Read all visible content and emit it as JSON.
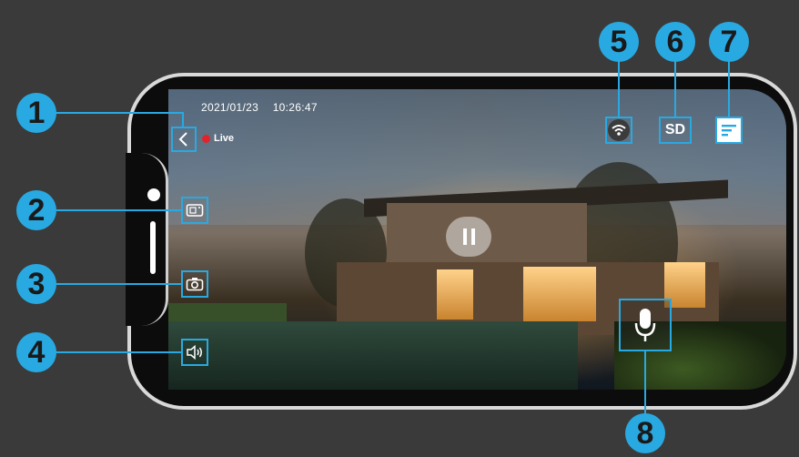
{
  "status": {
    "date": "2021/01/23",
    "time": "10:26:47",
    "live_label": "Live"
  },
  "controls": {
    "sd_label": "SD"
  },
  "callouts": [
    "1",
    "2",
    "3",
    "4",
    "5",
    "6",
    "7",
    "8"
  ],
  "icons": {
    "back": "chevron-left-icon",
    "snapshot": "screenshot-icon",
    "photo": "camera-icon",
    "speaker": "speaker-icon",
    "wifi": "wifi-icon",
    "menu": "menu-icon",
    "pause": "pause-icon",
    "mic": "microphone-icon"
  },
  "colors": {
    "accent": "#29a9e1",
    "live_dot": "#e3232a",
    "background": "#3a3a3a",
    "frame": "#d9d9d9"
  }
}
